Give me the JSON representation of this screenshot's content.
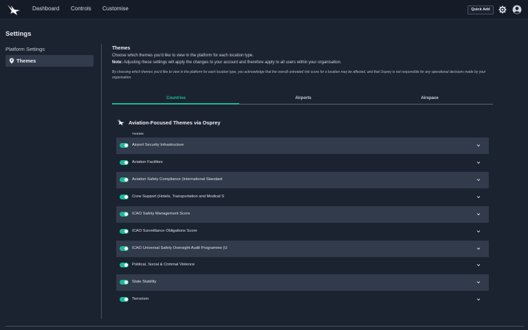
{
  "nav": {
    "links": [
      "Dashboard",
      "Controls",
      "Customise"
    ],
    "quick_add": "Quick Add"
  },
  "page": {
    "title": "Settings"
  },
  "sidebar": {
    "heading": "Platform Settings",
    "items": [
      {
        "label": "Themes",
        "icon": "map-pin-icon"
      }
    ]
  },
  "themes": {
    "title": "Themes",
    "description": "Choose which themes you'd like to view in the platform for each location type.",
    "note_label": "Note:",
    "note_text": " Adjusting these settings will apply the changes to your account and therefore apply to all users within your organisation.",
    "disclaimer": "By choosing which themes you'd like to view in the platform for each location type, you acknowledge that the overall untreated risk score for a location may be affected, and that Osprey is not responsible for any operational decisions made by your organisation.",
    "tabs": [
      {
        "label": "Countries",
        "active": true
      },
      {
        "label": "Airports",
        "active": false
      },
      {
        "label": "Airspace",
        "active": false
      }
    ],
    "group_title": "Aviation-Focused Themes via Osprey",
    "column_header": "THEME",
    "rows": [
      {
        "label": "Airport Security Infrastructure",
        "enabled": true
      },
      {
        "label": "Aviation Facilities",
        "enabled": true
      },
      {
        "label": "Aviation Safety Compliance (International Standard",
        "enabled": true
      },
      {
        "label": "Crew Support (Hotels, Transportation and Medical S",
        "enabled": true
      },
      {
        "label": "ICAO Safety Management Score",
        "enabled": true
      },
      {
        "label": "ICAO Surveillance Obligations Score",
        "enabled": true
      },
      {
        "label": "ICAO Universal Safety Oversight Audit Programme (U",
        "enabled": true
      },
      {
        "label": "Political, Social & Criminal Violence",
        "enabled": true
      },
      {
        "label": "State Stability",
        "enabled": true
      },
      {
        "label": "Terrorism",
        "enabled": true
      }
    ]
  },
  "colors": {
    "accent": "#1fb89a",
    "background": "#1b2230",
    "row_shade": "#323b4b"
  }
}
